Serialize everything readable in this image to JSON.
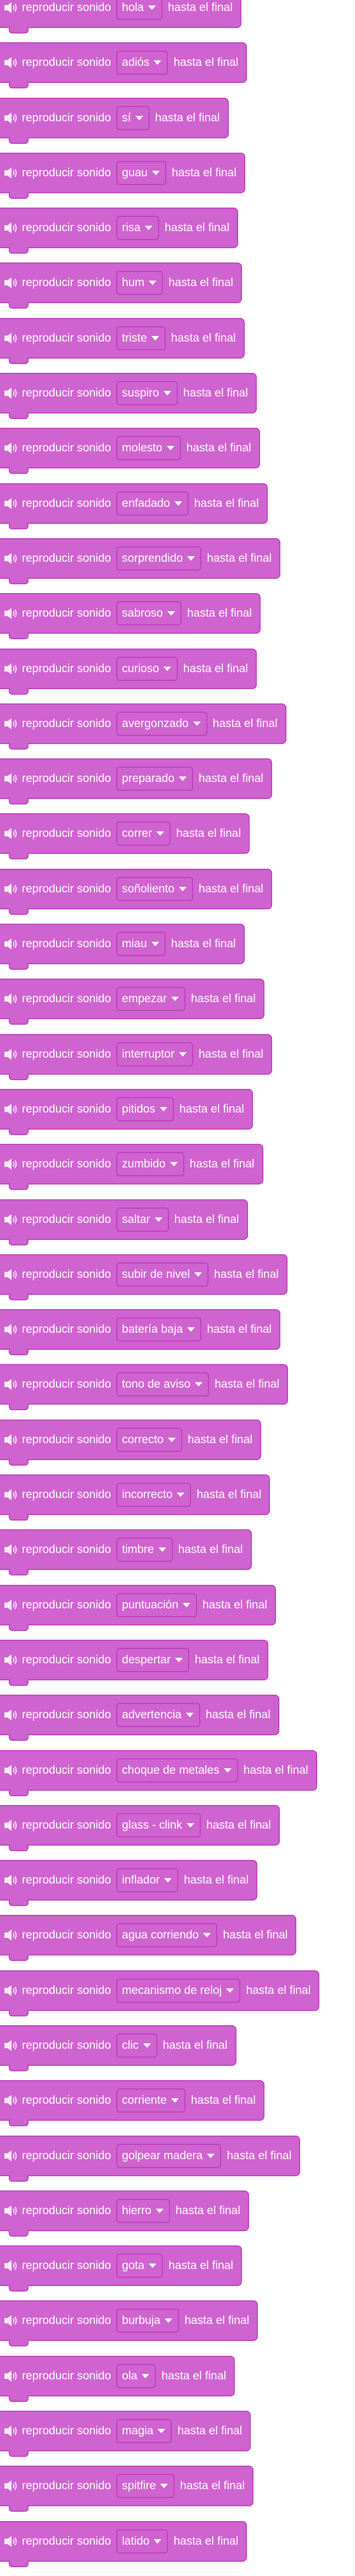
{
  "block_prefix": "reproducir sonido",
  "block_suffix": "hasta el final",
  "icon": "speaker-icon",
  "colors": {
    "block_fill": "#cf63cf",
    "block_border": "#bd42bd",
    "text": "#ffffff"
  },
  "sounds": [
    "hola",
    "adiós",
    "sí",
    "guau",
    "risa",
    "hum",
    "triste",
    "suspiro",
    "molesto",
    "enfadado",
    "sorprendido",
    "sabroso",
    "curioso",
    "avergonzado",
    "preparado",
    "correr",
    "soñoliento",
    "miau",
    "empezar",
    "interruptor",
    "pitidos",
    "zumbido",
    "saltar",
    "subir de nivel",
    "batería baja",
    "tono de aviso",
    "correcto",
    "incorrecto",
    "timbre",
    "puntuación",
    "despertar",
    "advertencia",
    "choque de metales",
    "glass - clink",
    "inflador",
    "agua corriendo",
    "mecanismo de reloj",
    "clic",
    "corriente",
    "golpear madera",
    "hierro",
    "gota",
    "burbuja",
    "ola",
    "magia",
    "spitfire",
    "latido"
  ]
}
